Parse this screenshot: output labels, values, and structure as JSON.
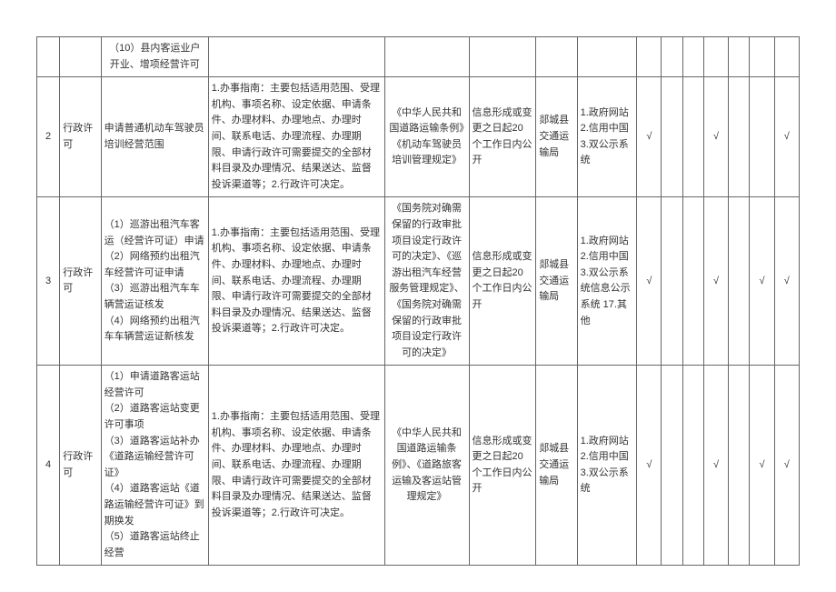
{
  "rows": [
    {
      "num": "",
      "type": "",
      "items": "（10）县内客运业户开业、增项经营许可",
      "guide": "",
      "law": "",
      "time": "",
      "org": "",
      "channel": "",
      "chk": [
        "",
        "",
        "",
        "",
        "",
        "",
        ""
      ]
    },
    {
      "num": "2",
      "type": "行政许可",
      "items": "申请普通机动车驾驶员培训经营范围",
      "guide": "1.办事指南：主要包括适用范围、受理机构、事项名称、设定依据、申请条件、办理材料、办理地点、办理时间、联系电话、办理流程、办理期限、申请行政许可需要提交的全部材料目录及办理情况、结果送达、监督投诉渠道等；2.行政许可决定。",
      "law": "《中华人民共和国道路运输条例》《机动车驾驶员培训管理规定》",
      "time": "信息形成或变更之日起20个工作日内公开",
      "org": "郯城县交通运输局",
      "channel": "1.政府网站 2.信用中国 3.双公示系统",
      "chk": [
        "√",
        "",
        "",
        "√",
        "",
        "",
        "√"
      ]
    },
    {
      "num": "3",
      "type": "行政许可",
      "items": "（1）巡游出租汽车客运（经营许可证）申请\n（2）网络预约出租汽车经营许可证申请\n（3）巡游出租汽车车辆营运证核发\n（4）网络预约出租汽车车辆营运证新核发",
      "guide": "1.办事指南：主要包括适用范围、受理机构、事项名称、设定依据、申请条件、办理材料、办理地点、办理时间、联系电话、办理流程、办理期限、申请行政许可需要提交的全部材料目录及办理情况、结果送达、监督投诉渠道等；2.行政许可决定。",
      "law": "《国务院对确需保留的行政审批项目设定行政许可的决定》、《巡游出租汽车经营服务管理规定》、《国务院对确需保留的行政审批项目设定行政许可的决定》",
      "time": "信息形成或变更之日起20个工作日内公开",
      "org": "郯城县交通运输局",
      "channel": "1.政府网站 2.信用中国 3.双公示系统信息公示系统 17.其他",
      "chk": [
        "√",
        "",
        "",
        "√",
        "",
        "√",
        "√"
      ]
    },
    {
      "num": "4",
      "type": "行政许可",
      "items": "（1）申请道路客运站经营许可\n（2）道路客运站变更许可事项\n（3）道路客运站补办《道路运输经营许可证》\n（4）道路客运站《道路运输经营许可证》到期换发\n（5）道路客运站终止经营",
      "guide": "1.办事指南：主要包括适用范围、受理机构、事项名称、设定依据、申请条件、办理材料、办理地点、办理时间、联系电话、办理流程、办理期限、申请行政许可需要提交的全部材料目录及办理情况、结果送达、监督投诉渠道等；2.行政许可决定。",
      "law": "《中华人民共和国道路运输条例》、《道路旅客运输及客运站管理规定》",
      "time": "信息形成或变更之日起20个工作日内公开",
      "org": "郯城县交通运输局",
      "channel": "1.政府网站 2.信用中国 3.双公示系统",
      "chk": [
        "√",
        "",
        "",
        "√",
        "",
        "√",
        "√"
      ]
    }
  ]
}
